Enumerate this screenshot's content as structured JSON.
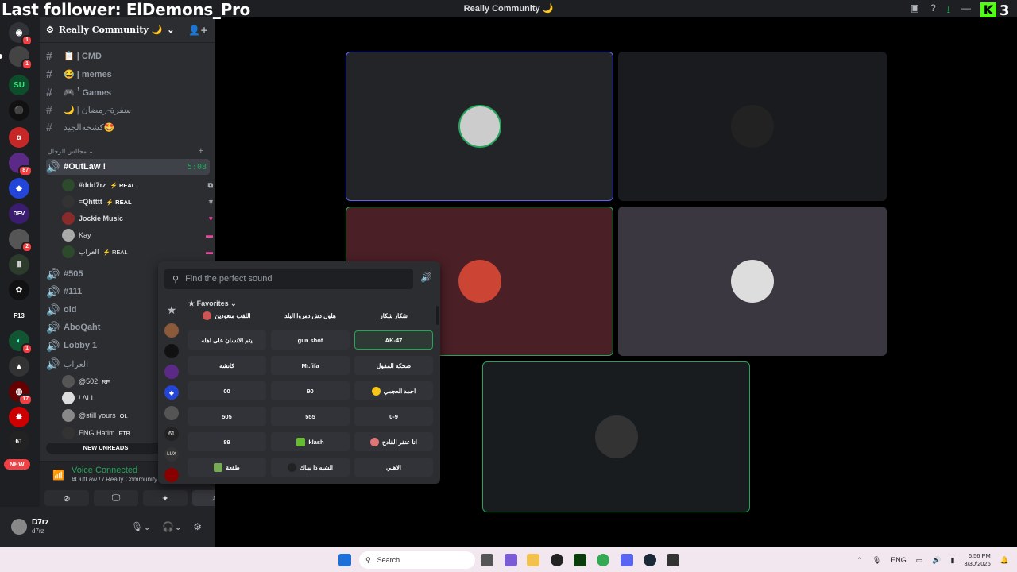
{
  "overlay": {
    "text": "Last follower: ElDemons_Pro",
    "kick_count": "3",
    "kick_logo": "K"
  },
  "window": {
    "title": "Really Community 🌙"
  },
  "server": {
    "name": "Really Community 🌙"
  },
  "server_badges": [
    "1",
    "",
    "",
    "",
    "",
    "87",
    "",
    "",
    "2",
    "",
    "",
    "",
    "1",
    "",
    "17",
    "",
    ""
  ],
  "new_pill": "NEW",
  "channels_top": [
    {
      "name": "📋 | CMD"
    },
    {
      "name": "😂 | memes"
    },
    {
      "name": "🎮 ꜝ Games"
    },
    {
      "name": "🌙 | سفرة-رمضان"
    },
    {
      "name": "كشخةالجيد🤩"
    }
  ],
  "category": {
    "name": "مجالس الرجال"
  },
  "active_channel": {
    "name": "#OutLaw !",
    "timer": "5:08"
  },
  "voice_users": [
    {
      "name": "#ddd7rz",
      "tag": "⚡ REAL"
    },
    {
      "name": "≡Qhtttt",
      "tag": "⚡ REAL"
    },
    {
      "name": "Jockie Music",
      "tag": ""
    },
    {
      "name": "Kay",
      "tag": ""
    },
    {
      "name": "العراب",
      "tag": "⚡ REAL"
    }
  ],
  "channels_mid": [
    {
      "name": "#505"
    },
    {
      "name": "#111"
    },
    {
      "name": "old"
    },
    {
      "name": "AboQaht"
    },
    {
      "name": "Lobby 1"
    },
    {
      "name": "العراب"
    }
  ],
  "lobby_users": [
    {
      "name": "@502",
      "tag": "RF"
    },
    {
      "name": "! ΛLI",
      "tag": ""
    },
    {
      "name": "@still yours",
      "tag": "OL"
    },
    {
      "name": "ENG.Hatim",
      "tag": "FTB"
    }
  ],
  "new_unreads": "NEW UNREADS",
  "voice": {
    "status": "Voice Connected",
    "channel": "#OutLaw ! / Really Community 🌙"
  },
  "user": {
    "name": "D7rz",
    "status": "d7rz"
  },
  "soundboard": {
    "placeholder": "Find the perfect sound",
    "favorites": "Favorites",
    "sounds": [
      "اللقب متعودين",
      "هلول دش دمروا البلد",
      "شكاز شكاز",
      "يتم الانسان على اهله",
      "gun shot",
      "AK-47",
      "كاتشه",
      "Mr.fifa",
      "ضحكه المقول",
      "00",
      "90",
      "احمد العجمي",
      "505",
      "555",
      "0-9",
      "89",
      "klash",
      "انا عنقر القادح",
      "طقعة",
      "الشبه دا بيباك",
      "الاهلي"
    ]
  },
  "taskbar": {
    "search": "Search",
    "lang": "ENG",
    "time": "6:56 PM",
    "date": "3/30/2026"
  },
  "colors": {
    "accent_green": "#23a55a",
    "blurple": "#5865f2",
    "red": "#f23f43"
  }
}
